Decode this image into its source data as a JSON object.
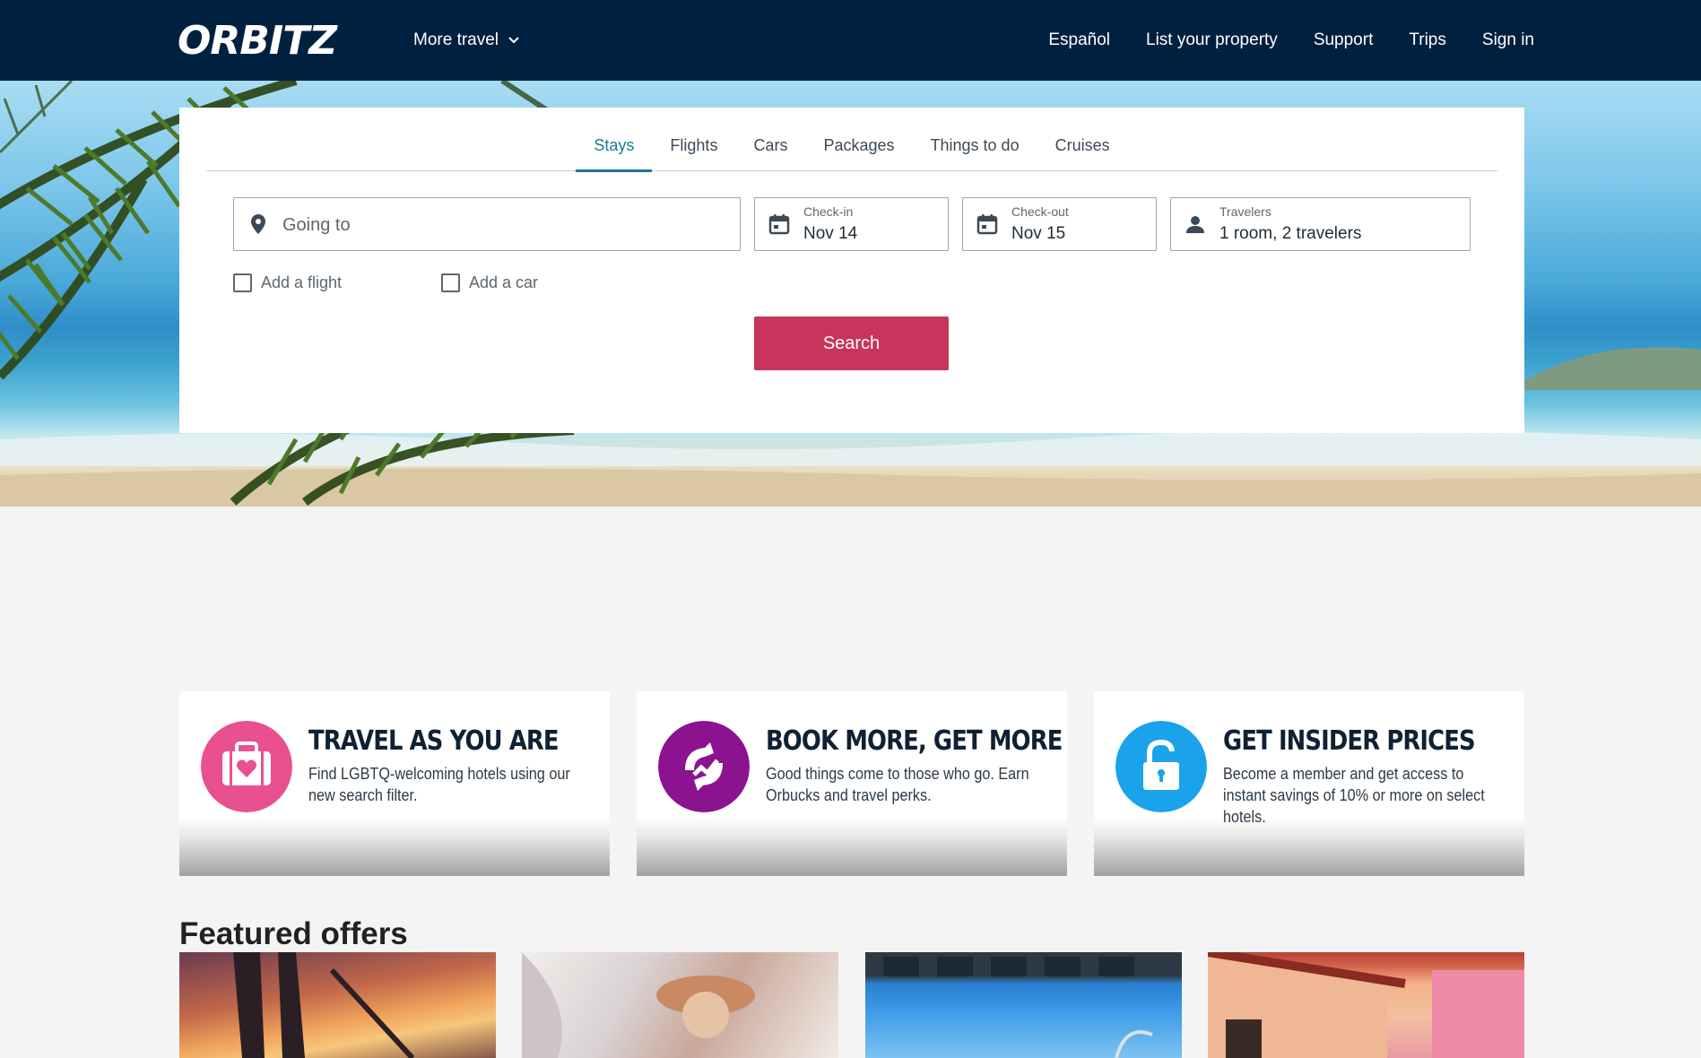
{
  "header": {
    "logo_text": "ORBITZ",
    "more_travel": "More travel",
    "nav": [
      "Español",
      "List your property",
      "Support",
      "Trips",
      "Sign in"
    ]
  },
  "search": {
    "tabs": [
      "Stays",
      "Flights",
      "Cars",
      "Packages",
      "Things to do",
      "Cruises"
    ],
    "active_tab": "Stays",
    "going_to_placeholder": "Going to",
    "checkin_label": "Check-in",
    "checkin_value": "Nov 14",
    "checkout_label": "Check-out",
    "checkout_value": "Nov 15",
    "travelers_label": "Travelers",
    "travelers_value": "1 room, 2 travelers",
    "add_flight": "Add a flight",
    "add_car": "Add a car",
    "search_button": "Search"
  },
  "promos": [
    {
      "title": "TRAVEL AS YOU ARE",
      "desc": "Find LGBTQ-welcoming hotels using our new search filter.",
      "icon": "suitcase-heart-icon",
      "color": "#e8508f"
    },
    {
      "title": "BOOK MORE, GET MORE",
      "desc": "Good things come to those who go. Earn Orbucks and travel perks.",
      "icon": "orbucks-icon",
      "color": "#8b1390"
    },
    {
      "title": "GET INSIDER PRICES",
      "desc": "Become a member and get access to instant savings of 10% or more on select hotels.",
      "icon": "unlock-icon",
      "color": "#1aa3ea"
    }
  ],
  "featured": {
    "title": "Featured offers"
  },
  "colors": {
    "header_bg": "#002040",
    "accent_tab": "#1a7a8f",
    "search_button": "#c8345a"
  }
}
